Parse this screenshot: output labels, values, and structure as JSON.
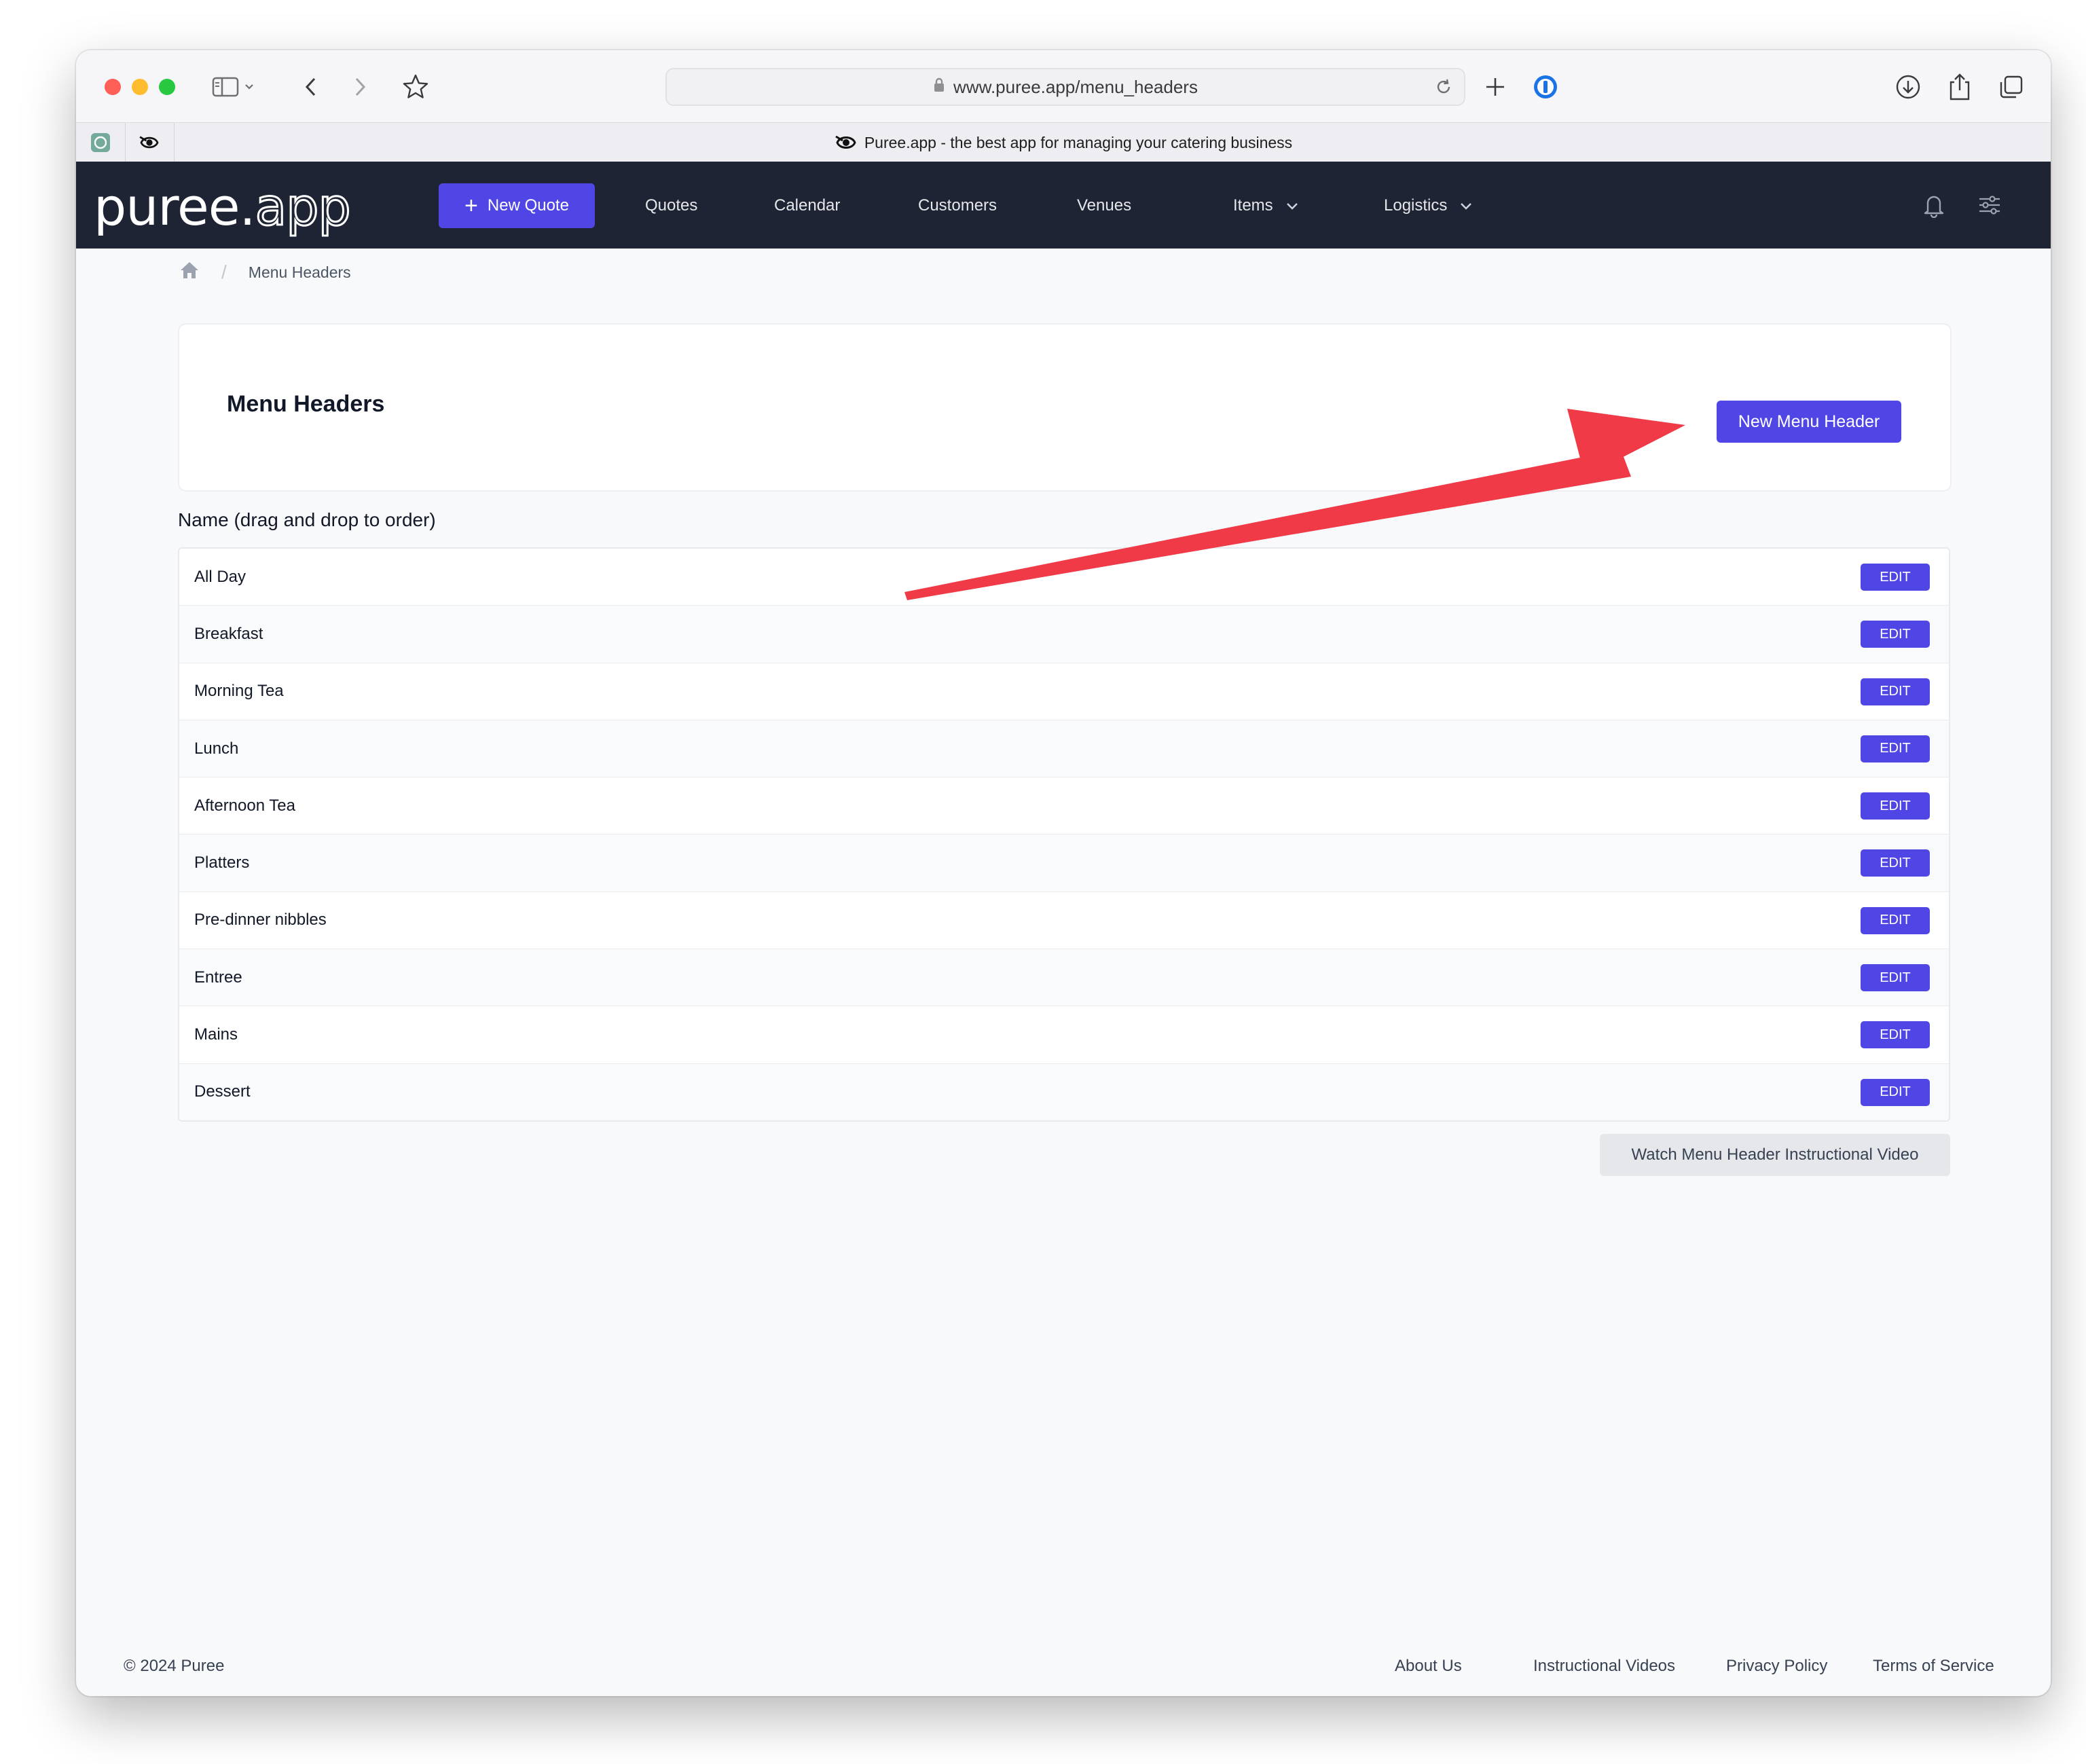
{
  "browser": {
    "url": "www.puree.app/menu_headers",
    "tab_title": "Puree.app - the best app for managing your catering business"
  },
  "navbar": {
    "logo_main": "puree.",
    "logo_accent": "app",
    "new_quote_label": "New Quote",
    "links": {
      "quotes": "Quotes",
      "calendar": "Calendar",
      "customers": "Customers",
      "venues": "Venues",
      "items": "Items",
      "logistics": "Logistics"
    }
  },
  "breadcrumb": {
    "current": "Menu Headers"
  },
  "header_card": {
    "title": "Menu Headers",
    "new_button_label": "New Menu Header"
  },
  "list": {
    "label": "Name (drag and drop to order)",
    "edit_label": "EDIT",
    "items": [
      "All Day",
      "Breakfast",
      "Morning Tea",
      "Lunch",
      "Afternoon Tea",
      "Platters",
      "Pre-dinner nibbles",
      "Entree",
      "Mains",
      "Dessert"
    ]
  },
  "video_button_label": "Watch Menu Header Instructional Video",
  "footer": {
    "copyright": "© 2024 Puree",
    "links": {
      "about": "About Us",
      "videos": "Instructional Videos",
      "privacy": "Privacy Policy",
      "terms": "Terms of Service"
    }
  },
  "colors": {
    "primary": "#4f46e5",
    "navbar_bg": "#1e2433",
    "annotation_arrow": "#f03a47"
  }
}
